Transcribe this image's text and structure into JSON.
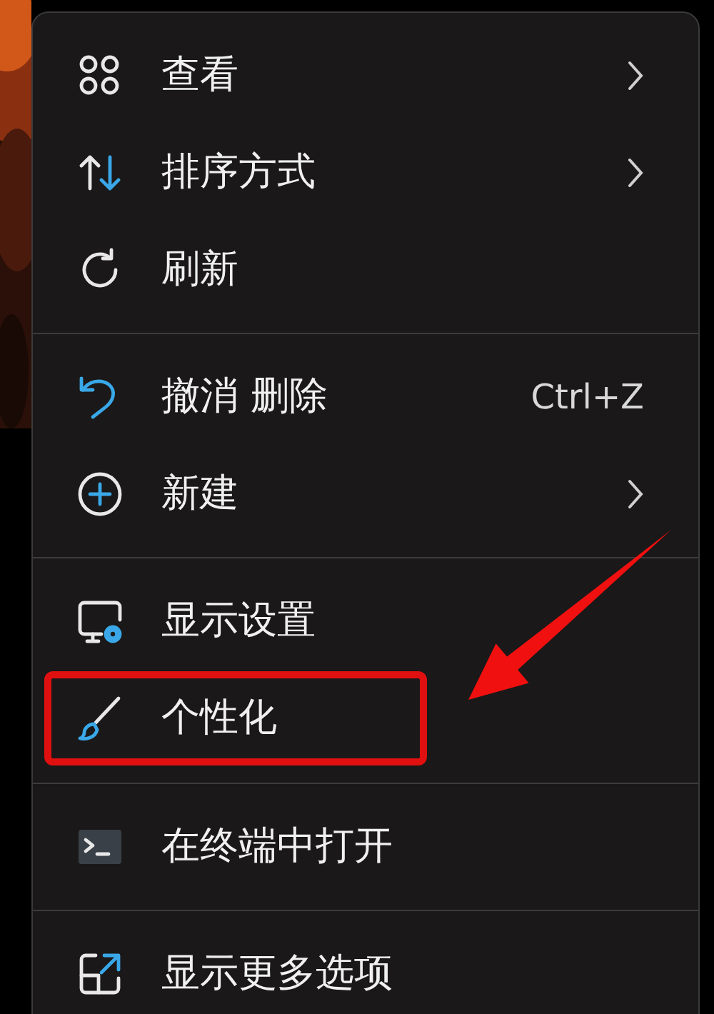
{
  "menu": {
    "groups": [
      {
        "items": [
          {
            "kind": "grid",
            "label": "查看",
            "submenu": true,
            "annotated": false
          },
          {
            "kind": "sort",
            "label": "排序方式",
            "submenu": true,
            "annotated": false
          },
          {
            "kind": "refresh",
            "label": "刷新",
            "submenu": false,
            "annotated": false
          }
        ]
      },
      {
        "items": [
          {
            "kind": "undo",
            "label": "撤消 删除",
            "shortcut": "Ctrl+Z",
            "submenu": false,
            "annotated": false
          },
          {
            "kind": "plus",
            "label": "新建",
            "submenu": true,
            "annotated": false
          }
        ]
      },
      {
        "items": [
          {
            "kind": "display",
            "label": "显示设置",
            "submenu": false,
            "annotated": false
          },
          {
            "kind": "brush",
            "label": "个性化",
            "submenu": false,
            "annotated": true
          }
        ]
      },
      {
        "items": [
          {
            "kind": "terminal",
            "label": "在终端中打开",
            "submenu": false,
            "annotated": false
          }
        ]
      },
      {
        "items": [
          {
            "kind": "expand",
            "label": "显示更多选项",
            "submenu": false,
            "annotated": false
          }
        ]
      }
    ]
  }
}
